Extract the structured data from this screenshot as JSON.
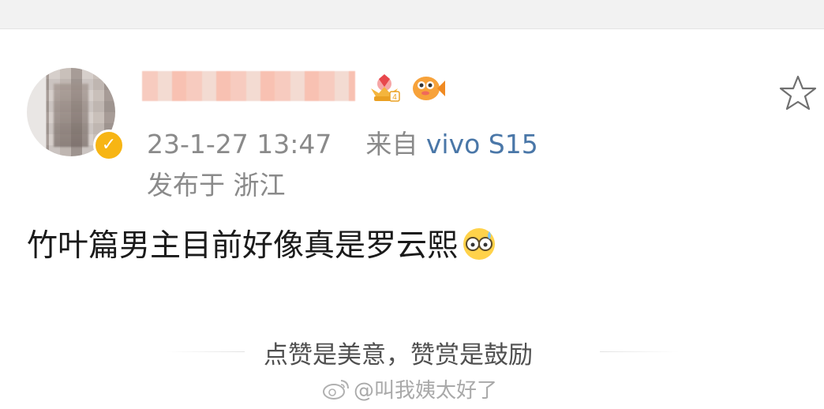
{
  "post": {
    "author": {
      "avatar_icon": "avatar",
      "verified_icon": "verified-badge-icon",
      "badges": [
        "crown-level-icon",
        "fish-icon"
      ]
    },
    "timestamp": "23-1-27 13:47",
    "source_prefix": "来自",
    "source_device": "vivo S15",
    "location": "发布于 浙江",
    "content_text": "竹叶篇男主目前好像真是罗云熙",
    "content_emoji": "sweat-glasses-emoji"
  },
  "actions": {
    "favorite_icon": "star-icon"
  },
  "reward": {
    "text": "点赞是美意，赞赏是鼓励"
  },
  "watermark": {
    "text": "@叫我姨太好了"
  },
  "colors": {
    "background": "#ffffff",
    "meta_text": "#8a8a8a",
    "device_link": "#4a77a8",
    "verified": "#f7b514"
  }
}
